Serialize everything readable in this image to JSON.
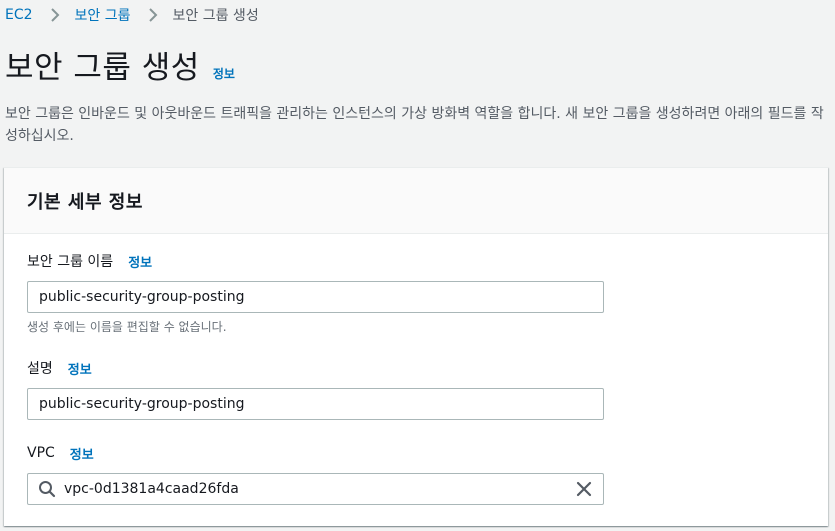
{
  "breadcrumb": {
    "items": [
      "EC2",
      "보안 그룹",
      "보안 그룹 생성"
    ]
  },
  "header": {
    "title": "보안 그룹 생성",
    "info_link": "정보",
    "description": "보안 그룹은 인바운드 및 아웃바운드 트래픽을 관리하는 인스턴스의 가상 방화벽 역할을 합니다. 새 보안 그룹을 생성하려면 아래의 필드를 작성하십시오."
  },
  "panel": {
    "title": "기본 세부 정보",
    "fields": {
      "name": {
        "label": "보안 그룹 이름",
        "info_link": "정보",
        "value": "public-security-group-posting",
        "constraint": "생성 후에는 이름을 편집할 수 없습니다."
      },
      "description": {
        "label": "설명",
        "info_link": "정보",
        "value": "public-security-group-posting"
      },
      "vpc": {
        "label": "VPC",
        "info_link": "정보",
        "value": "vpc-0d1381a4caad26fda",
        "leading_icon": "search-icon",
        "trailing_icon": "close-icon"
      }
    }
  },
  "colors": {
    "link": "#0073bb",
    "background": "#f2f3f3",
    "text": "#16191f",
    "secondary_text": "#545b64"
  }
}
